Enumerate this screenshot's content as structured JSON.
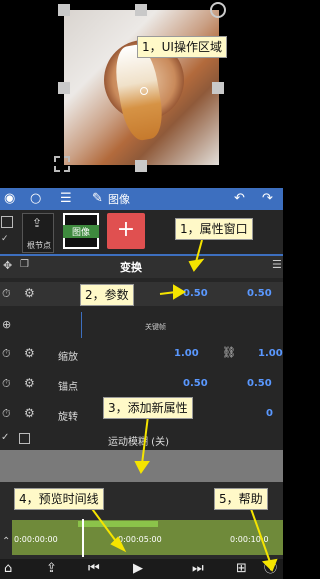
{
  "preview": {
    "rotate_icon": "rotate-icon"
  },
  "toolbar": {
    "title": "图像",
    "icons": [
      "eye-icon",
      "circle-icon",
      "menu-icon",
      "pencil-icon",
      "undo-icon",
      "redo-icon"
    ]
  },
  "layers": {
    "keynode_label": "根节点",
    "layer_label": "图像",
    "add_label": "+"
  },
  "section": {
    "title": "变换",
    "keyframe_label": "关键帧"
  },
  "properties": [
    {
      "name": "",
      "values": [
        "0.50",
        "0.50"
      ]
    },
    {
      "name": "缩放",
      "values": [
        "1.00",
        "1.00"
      ]
    },
    {
      "name": "锚点",
      "values": [
        "0.50",
        "0.50"
      ]
    },
    {
      "name": "旋转",
      "values": [
        "0"
      ]
    }
  ],
  "motion_blur": "运动模糊 (关)",
  "timeline": {
    "times": [
      "0:00:00:00",
      "0:00:05:00",
      "0:00:10:0"
    ]
  },
  "callouts": {
    "c1": "1，UI操作区域",
    "c2": "1，属性窗口",
    "c3": "2，参数",
    "c4": "3，添加新属性",
    "c5": "4，预览时间线",
    "c6": "5，帮助"
  },
  "colors": {
    "accent": "#3d6fbf",
    "value": "#5a98ff",
    "add_button": "#e05050",
    "callout_bg": "#fff9c8",
    "arrow": "#f5e400"
  }
}
